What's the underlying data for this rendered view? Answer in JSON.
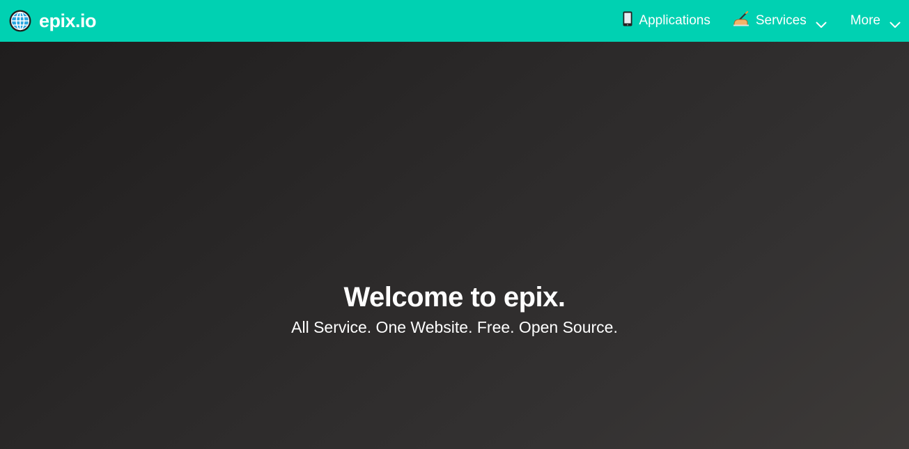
{
  "navbar": {
    "brand": {
      "text": "epix.io",
      "icon": "globe-icon"
    },
    "items": [
      {
        "label": "Applications",
        "icon": "mobile-phone-icon",
        "has_dropdown": false
      },
      {
        "label": "Services",
        "icon": "writing-hand-icon",
        "has_dropdown": true
      },
      {
        "label": "More",
        "icon": "",
        "has_dropdown": true
      }
    ],
    "background_color": "#00d1b2"
  },
  "hero": {
    "title": "Welcome to epix.",
    "subtitle": "All Service. One Website. Free. Open Source."
  }
}
